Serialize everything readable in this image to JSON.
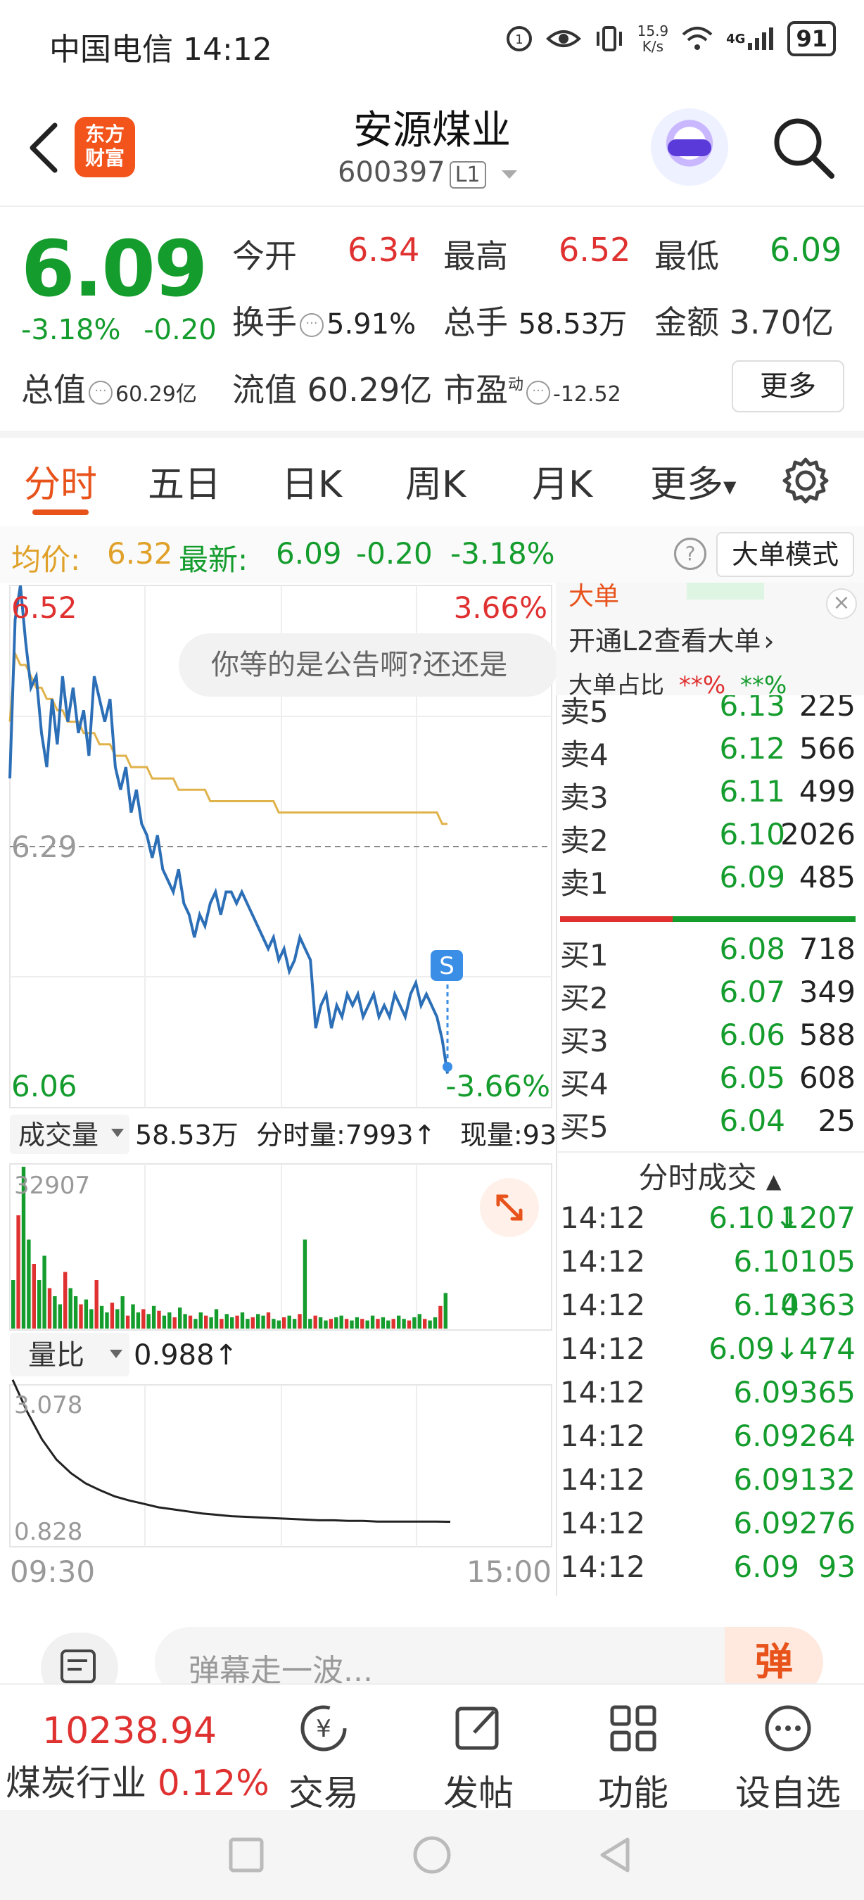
{
  "status_bar": {
    "carrier_time": "中国电信 14:12",
    "net_speed_top": "15.9",
    "net_speed_unit": "K/s",
    "signal_label": "4G",
    "battery": "91"
  },
  "header": {
    "logo_line1": "东方",
    "logo_line2": "财富",
    "stock_name": "安源煤业",
    "stock_code": "600397",
    "level_badge": "L1"
  },
  "quote": {
    "price": "6.09",
    "change_pct": "-3.18%",
    "change_abs": "-0.20",
    "open_label": "今开",
    "open_value": "6.34",
    "high_label": "最高",
    "high_value": "6.52",
    "low_label": "最低",
    "low_value": "6.09",
    "turnover_label": "换手",
    "turnover_value": "5.91%",
    "volume_label": "总手",
    "volume_value": "58.53万",
    "amount_label": "金额",
    "amount_value": "3.70亿",
    "mktcap_label": "总值",
    "mktcap_value": "60.29亿",
    "float_label": "流值",
    "float_value": "60.29亿",
    "pe_label": "市盈",
    "pe_sup": "动",
    "pe_value": "-12.52",
    "more_button": "更多"
  },
  "tabs": [
    "分时",
    "五日",
    "日K",
    "周K",
    "月K",
    "更多"
  ],
  "avg_row": {
    "avg_label": "均价:",
    "avg_value": "6.32",
    "latest_label": "最新:",
    "latest_value": "6.09",
    "latest_chg": "-0.20",
    "latest_pct": "-3.18%",
    "help": "?",
    "big_order_mode": "大单模式"
  },
  "banner": {
    "big_order_title": "大单",
    "open_l2": "开通L2查看大单",
    "big_ratio": "大单占比",
    "stars1": "**%",
    "stars2": "**%",
    "close": "×",
    "bubble_text": "你等的是公告啊?还还是"
  },
  "chart_data": {
    "type": "line",
    "title": "",
    "y_max_label": "6.52",
    "y_mid_label": "6.29",
    "y_min_label": "6.06",
    "pct_max_label": "3.66%",
    "pct_min_label": "-3.66%",
    "ylim": [
      6.06,
      6.52
    ],
    "prev_close": 6.29,
    "x_start_label": "09:30",
    "x_end_label": "15:00",
    "signal_marker": "S",
    "series": [
      {
        "name": "",
        "color": "#2c6fb7",
        "values": [
          6.35,
          6.49,
          6.52,
          6.47,
          6.43,
          6.44,
          6.39,
          6.36,
          6.42,
          6.38,
          6.44,
          6.4,
          6.43,
          6.39,
          6.41,
          6.37,
          6.44,
          6.42,
          6.4,
          6.42,
          6.36,
          6.34,
          6.36,
          6.32,
          6.34,
          6.31,
          6.3,
          6.28,
          6.3,
          6.27,
          6.26,
          6.25,
          6.27,
          6.24,
          6.23,
          6.21,
          6.23,
          6.22,
          6.24,
          6.25,
          6.23,
          6.25,
          6.25,
          6.24,
          6.25,
          6.24,
          6.23,
          6.22,
          6.21,
          6.2,
          6.21,
          6.19,
          6.2,
          6.18,
          6.19,
          6.21,
          6.2,
          6.19,
          6.13,
          6.15,
          6.16,
          6.13,
          6.15,
          6.14,
          6.16,
          6.15,
          6.16,
          6.14,
          6.15,
          6.16,
          6.14,
          6.15,
          6.14,
          6.16,
          6.15,
          6.14,
          6.16,
          6.17,
          6.15,
          6.16,
          6.15,
          6.14,
          6.12,
          6.09
        ]
      },
      {
        "name": "",
        "color": "#e0b24a",
        "values": [
          6.4,
          6.46,
          6.45,
          6.45,
          6.44,
          6.43,
          6.43,
          6.42,
          6.42,
          6.41,
          6.41,
          6.4,
          6.4,
          6.4,
          6.39,
          6.39,
          6.39,
          6.38,
          6.38,
          6.38,
          6.37,
          6.37,
          6.37,
          6.36,
          6.36,
          6.36,
          6.36,
          6.35,
          6.35,
          6.35,
          6.35,
          6.35,
          6.34,
          6.34,
          6.34,
          6.34,
          6.34,
          6.34,
          6.33,
          6.33,
          6.33,
          6.33,
          6.33,
          6.33,
          6.33,
          6.33,
          6.33,
          6.33,
          6.33,
          6.33,
          6.33,
          6.32,
          6.32,
          6.32,
          6.32,
          6.32,
          6.32,
          6.32,
          6.32,
          6.32,
          6.32,
          6.32,
          6.32,
          6.32,
          6.32,
          6.32,
          6.32,
          6.32,
          6.32,
          6.32,
          6.32,
          6.32,
          6.32,
          6.32,
          6.32,
          6.32,
          6.32,
          6.32,
          6.32,
          6.32,
          6.32,
          6.32,
          6.31,
          6.31
        ]
      }
    ],
    "volume": {
      "label": "成交量",
      "total": "58.53万",
      "min_label": "分时量:7993↑",
      "now_label": "现量:93",
      "max_label": "32907",
      "bars": [
        30,
        70,
        100,
        55,
        40,
        30,
        45,
        25,
        20,
        15,
        35,
        25,
        20,
        15,
        18,
        12,
        30,
        14,
        10,
        16,
        12,
        20,
        8,
        15,
        10,
        12,
        9,
        14,
        11,
        8,
        10,
        7,
        13,
        9,
        8,
        6,
        10,
        8,
        7,
        12,
        6,
        9,
        7,
        8,
        10,
        6,
        7,
        9,
        8,
        10,
        6,
        5,
        7,
        8,
        6,
        9,
        55,
        6,
        8,
        7,
        5,
        6,
        7,
        8,
        6,
        5,
        7,
        6,
        5,
        8,
        6,
        7,
        5,
        6,
        8,
        6,
        5,
        7,
        9,
        6,
        5,
        7,
        14,
        22
      ]
    },
    "volume_ratio": {
      "label": "量比",
      "value": "0.988↑",
      "max_label": "3.078",
      "min_label": "0.828",
      "values": [
        3.07,
        2.6,
        2.2,
        1.9,
        1.7,
        1.55,
        1.45,
        1.36,
        1.3,
        1.25,
        1.2,
        1.17,
        1.14,
        1.11,
        1.09,
        1.07,
        1.06,
        1.05,
        1.04,
        1.03,
        1.02,
        1.01,
        1.01,
        1.0,
        1.0,
        0.99,
        0.99,
        0.99,
        0.99,
        0.99,
        0.988
      ]
    }
  },
  "order_book": {
    "asks": [
      {
        "label": "卖5",
        "price": "6.13",
        "vol": "225"
      },
      {
        "label": "卖4",
        "price": "6.12",
        "vol": "566"
      },
      {
        "label": "卖3",
        "price": "6.11",
        "vol": "499"
      },
      {
        "label": "卖2",
        "price": "6.10",
        "vol": "2026"
      },
      {
        "label": "卖1",
        "price": "6.09",
        "vol": "485"
      }
    ],
    "bids": [
      {
        "label": "买1",
        "price": "6.08",
        "vol": "718"
      },
      {
        "label": "买2",
        "price": "6.07",
        "vol": "349"
      },
      {
        "label": "买3",
        "price": "6.06",
        "vol": "588"
      },
      {
        "label": "买4",
        "price": "6.05",
        "vol": "608"
      },
      {
        "label": "买5",
        "price": "6.04",
        "vol": "25"
      }
    ],
    "ticks_title": "分时成交",
    "ticks": [
      {
        "time": "14:12",
        "price": "6.10↓",
        "vol": "1207"
      },
      {
        "time": "14:12",
        "price": "6.10",
        "vol": "105"
      },
      {
        "time": "14:12",
        "price": "6.10",
        "vol": "4363"
      },
      {
        "time": "14:12",
        "price": "6.09↓",
        "vol": "474"
      },
      {
        "time": "14:12",
        "price": "6.09",
        "vol": "365"
      },
      {
        "time": "14:12",
        "price": "6.09",
        "vol": "264"
      },
      {
        "time": "14:12",
        "price": "6.09",
        "vol": "132"
      },
      {
        "time": "14:12",
        "price": "6.09",
        "vol": "276"
      },
      {
        "time": "14:12",
        "price": "6.09",
        "vol": "93"
      }
    ]
  },
  "comment_bar": {
    "placeholder": "弹幕走一波...",
    "danmu_btn": "弹"
  },
  "bottom_bar": {
    "index_value": "10238.94",
    "index_name": "煤炭行业",
    "index_pct": "0.12%",
    "trade": "交易",
    "post": "发帖",
    "function": "功能",
    "watchlist": "设自选"
  },
  "colors": {
    "up": "#e03131",
    "down": "#149c2d",
    "accent": "#e8531b",
    "price_line": "#2c6fb7",
    "avg_line": "#e0b24a"
  }
}
